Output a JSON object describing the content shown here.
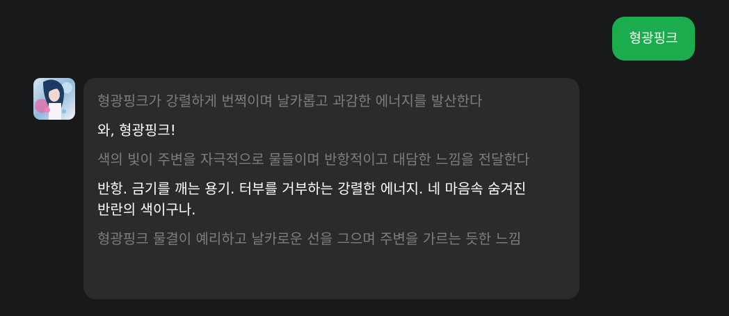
{
  "conversation": {
    "user_message": "형광핑크",
    "bot": {
      "avatar_icon": "character-avatar-icon",
      "paragraphs": [
        {
          "kind": "narration",
          "text": "형광핑크가 강렬하게 번쩍이며 날카롭고 과감한 에너지를 발산한다"
        },
        {
          "kind": "speech",
          "text": "와, 형광핑크!"
        },
        {
          "kind": "narration",
          "text": "색의 빛이 주변을 자극적으로 물들이며 반항적이고 대담한 느낌을 전달한다"
        },
        {
          "kind": "speech",
          "text": "반항. 금기를 깨는 용기. 터부를 거부하는 강렬한 에너지. 네 마음속 숨겨진 반란의 색이구나."
        },
        {
          "kind": "narration",
          "text": "형광핑크 물결이 예리하고 날카로운 선을 그으며 주변을 가르는 듯한 느낌"
        }
      ]
    }
  },
  "colors": {
    "background": "#18191b",
    "user_bubble": "#1bad4d",
    "bot_bubble": "#2b2b2b",
    "narration_text": "#7d7d7d",
    "speech_text": "#ffffff"
  }
}
